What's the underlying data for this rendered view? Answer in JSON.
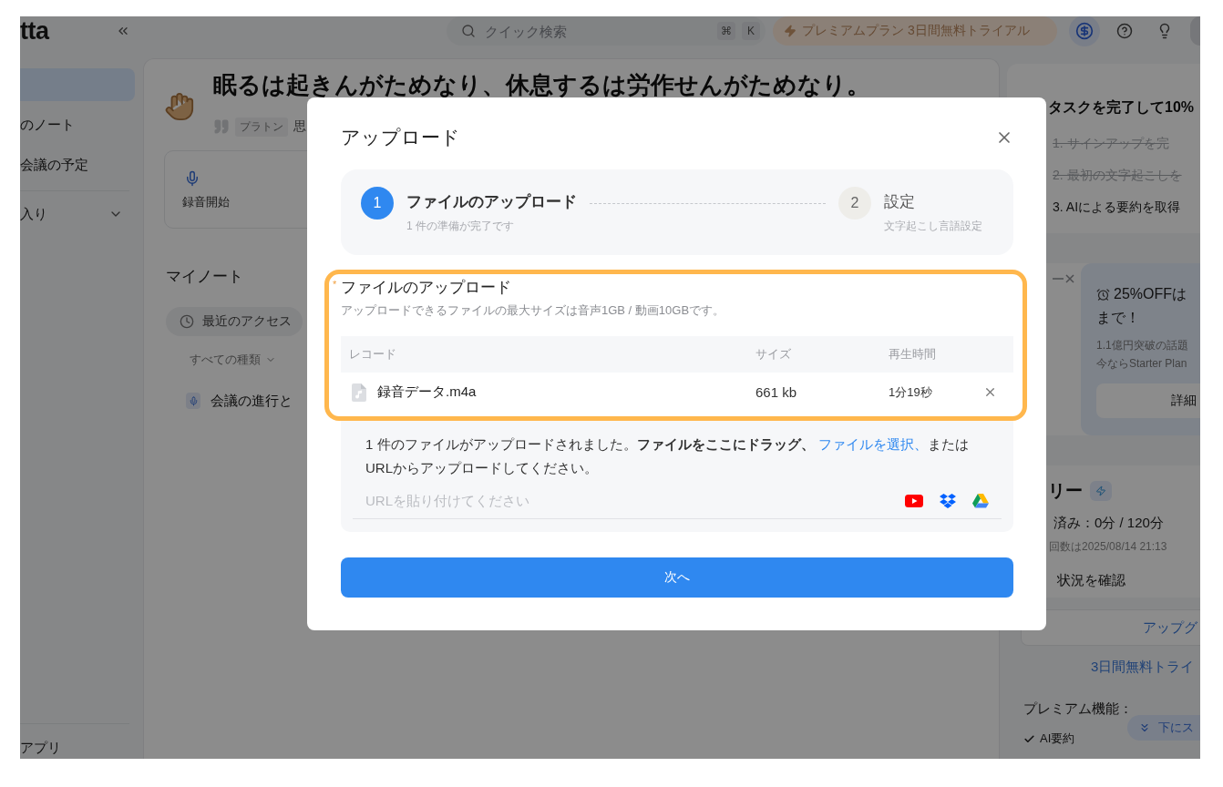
{
  "topbar": {
    "logo": "tta",
    "search": {
      "placeholder": "クイック検索",
      "keys": [
        "⌘",
        "K"
      ]
    },
    "premium": "プレミアムプラン 3日間無料トライアル"
  },
  "sidebar": {
    "items": [
      {
        "selected": true
      },
      {
        "label": "のノート",
        "selected": false
      },
      {
        "label": "会議の予定",
        "selected": false
      }
    ],
    "section": "入り",
    "footer": "アプリ"
  },
  "main": {
    "quote": {
      "text": "眠るは起きんがためなり、休息するは労作せんがためなり。",
      "author": "プラトン",
      "source": "思"
    },
    "action_cards": [
      "録音開始"
    ],
    "notes": {
      "title": "マイノート",
      "filter": "最近のアクセス",
      "type_filter": "すべての種類",
      "items": [
        "会議の進行と"
      ]
    }
  },
  "right_panel": {
    "tasks": {
      "title": "タスクを完了して10%",
      "items": [
        {
          "text": "1. サインアップを完",
          "done": true
        },
        {
          "text": "2. 最初の文字起こしを",
          "done": true
        },
        {
          "text": "3. AIによる要約を取得",
          "done": false
        }
      ]
    },
    "promo": {
      "lines": [
        "25%OFFは",
        "まで！"
      ],
      "details": [
        "1.1億円突破の話題",
        "今ならStarter Plan"
      ],
      "button": "詳細"
    },
    "usage": {
      "title": "リー",
      "used": "済み：0分 / 120分",
      "reset": "回数は2025/08/14 21:13",
      "link": "状況を確認"
    },
    "upgrade_button": "アップグ",
    "trial_link": "3日間無料トライ",
    "features_title": "プレミアム機能：",
    "features": [
      "AI要約"
    ],
    "scroll_button": "下にス"
  },
  "modal": {
    "title": "アップロード",
    "steps": [
      {
        "number": "1",
        "title": "ファイルのアップロード",
        "subtitle": "1 件の準備が完了です",
        "selected": true
      },
      {
        "number": "2",
        "title": "設定",
        "subtitle": "文字起こし言語設定",
        "selected": false
      }
    ],
    "upload": {
      "highlighted": true,
      "required_mark": "*",
      "label": "ファイルのアップロード",
      "hint": "アップロードできるファイルの最大サイズは音声1GB / 動画10GBです。",
      "columns": [
        "レコード",
        "サイズ",
        "再生時間"
      ],
      "rows": [
        {
          "name": "録音データ.m4a",
          "size": "661 kb",
          "duration": "1分19秒"
        }
      ]
    },
    "drop_zone": {
      "message_start": "1 件のファイルがアップロードされました。**ファイルをここにドラッグ、**",
      "link": "ファイルを選択、",
      "message_end": "またはURLからアップロードしてください。",
      "url_field": {
        "placeholder": "URLを貼り付けてください"
      }
    },
    "next_button": "次へ"
  }
}
